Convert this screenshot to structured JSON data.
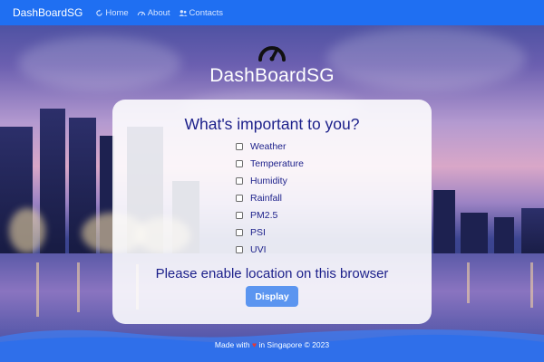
{
  "navbar": {
    "brand": "DashBoardSG",
    "links": [
      {
        "label": "Home",
        "icon": "refresh-icon"
      },
      {
        "label": "About",
        "icon": "gauge-icon"
      },
      {
        "label": "Contacts",
        "icon": "users-icon"
      }
    ]
  },
  "hero": {
    "icon": "speedometer-icon",
    "title": "DashBoardSG"
  },
  "card": {
    "title": "What's important to you?",
    "options": [
      "Weather",
      "Temperature",
      "Humidity",
      "Rainfall",
      "PM2.5",
      "PSI",
      "UVI"
    ],
    "location_message": "Please enable location on this browser",
    "display_button": "Display"
  },
  "footer": {
    "made_with": "Made with",
    "heart": "♥",
    "rest": "in Singapore © 2023"
  },
  "colors": {
    "navbar": "#1f6ff2",
    "accent_text": "#1b1f8a",
    "button": "#5b95f0"
  }
}
